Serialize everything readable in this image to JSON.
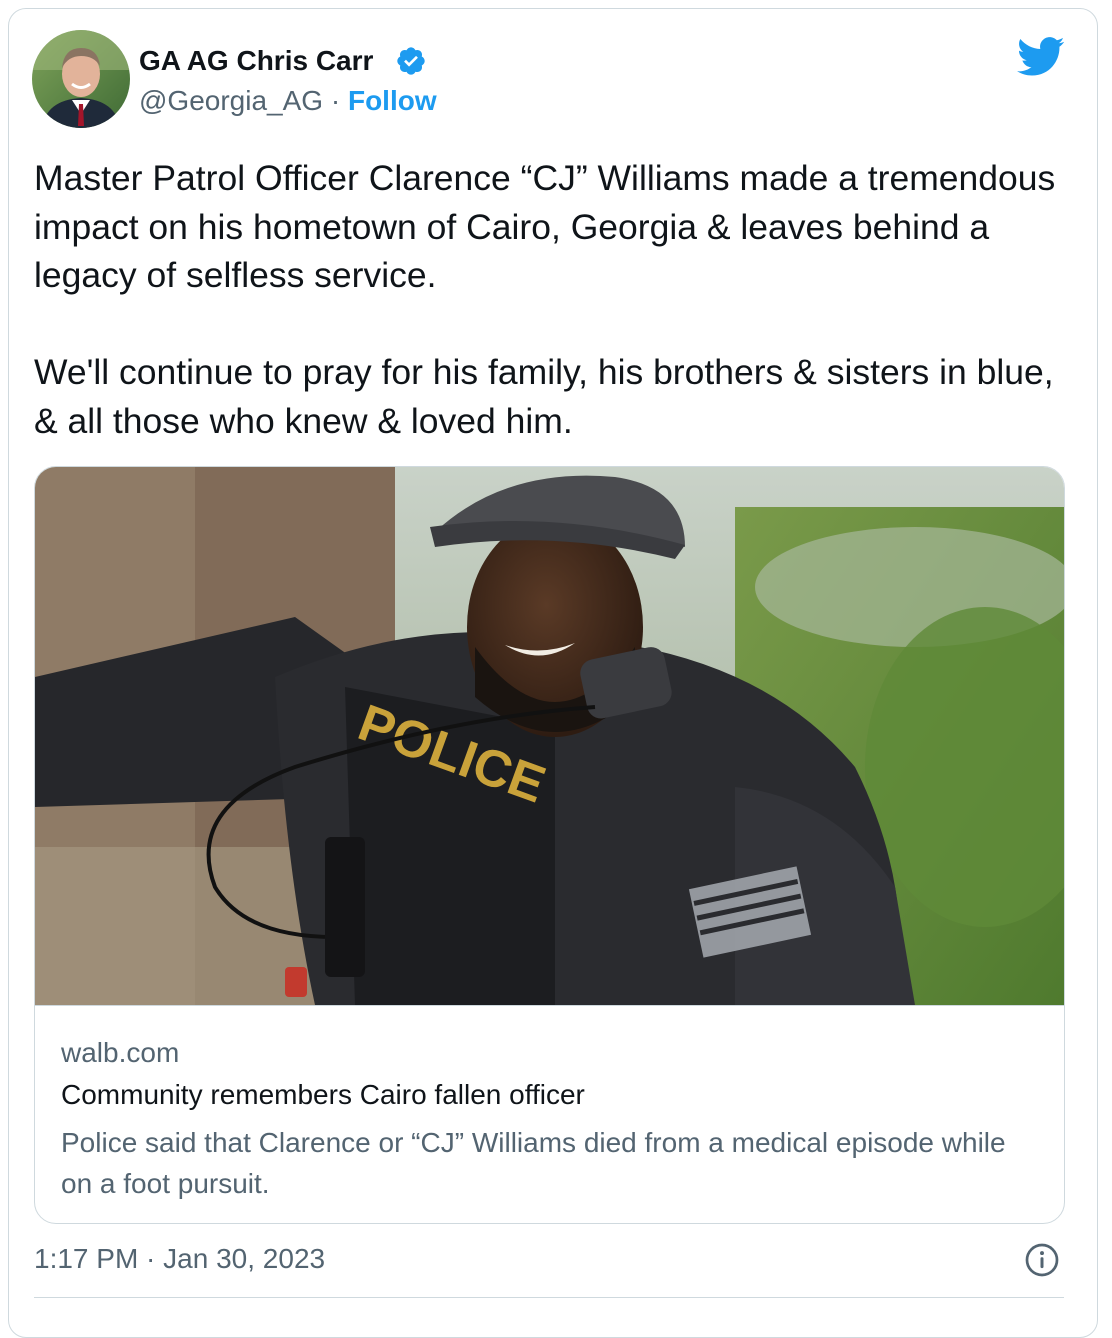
{
  "tweet": {
    "author": {
      "display_name": "GA AG Chris Carr",
      "handle": "@Georgia_AG",
      "separator": " · ",
      "follow_label": "Follow"
    },
    "text": [
      "Master Patrol Officer Clarence “CJ” Williams made a tremendous impact on his hometown of Cairo, Georgia & leaves behind a legacy of selfless service.",
      "We'll continue to pray for his family, his brothers & sisters in blue, & all those who knew & loved him."
    ],
    "link_card": {
      "image_vest_text": "POLICE",
      "domain": "walb.com",
      "title": "Community remembers Cairo fallen officer",
      "description": "Police said that Clarence or “CJ” Williams died from a medical episode while on a foot pursuit."
    },
    "time": "1:17 PM",
    "date_separator": " · ",
    "date": "Jan 30, 2023"
  },
  "colors": {
    "twitter_blue": "#1d9bf0",
    "text_primary": "#0f1419",
    "text_secondary": "#536471",
    "border": "#cfd9de"
  },
  "icons": {
    "brand": "twitter-bird-icon",
    "verified": "verified-badge-icon",
    "info": "info-icon"
  }
}
